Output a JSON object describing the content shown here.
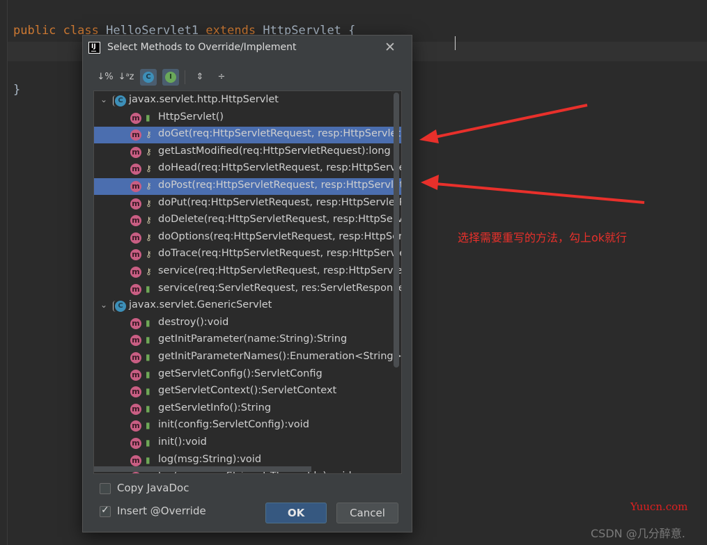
{
  "editor": {
    "line1": {
      "kw1": "public",
      "kw2": "class",
      "name": "HelloServlet1",
      "kw3": "extends",
      "parent": "HttpServlet",
      "brace": "{"
    },
    "line2": {
      "brace": "}"
    }
  },
  "dialog": {
    "app_icon_text": "IJ",
    "title": "Select Methods to Override/Implement",
    "close_glyph": "✕",
    "toolbar": [
      {
        "icon": "sort-visibility-icon",
        "glyph": "↓%"
      },
      {
        "icon": "sort-alpha-icon",
        "glyph": "↓ᵃz"
      },
      {
        "icon": "show-classes-icon",
        "glyph": "C"
      },
      {
        "icon": "show-interfaces-icon",
        "glyph": "I"
      },
      {
        "icon": "expand-all-icon",
        "glyph": "⇕"
      },
      {
        "icon": "collapse-all-icon",
        "glyph": "÷"
      }
    ],
    "tree": [
      {
        "type": "class",
        "label": "javax.servlet.http.HttpServlet",
        "icon_letter": "C"
      },
      {
        "type": "method",
        "label": "HttpServlet()",
        "visibility": "public",
        "selected": false
      },
      {
        "type": "method",
        "label": "doGet(req:HttpServletRequest, resp:HttpServletR",
        "visibility": "protected",
        "selected": true
      },
      {
        "type": "method",
        "label": "getLastModified(req:HttpServletRequest):long",
        "visibility": "protected",
        "selected": false
      },
      {
        "type": "method",
        "label": "doHead(req:HttpServletRequest, resp:HttpServle",
        "visibility": "protected",
        "selected": false
      },
      {
        "type": "method",
        "label": "doPost(req:HttpServletRequest, resp:HttpServlet",
        "visibility": "protected",
        "selected": true
      },
      {
        "type": "method",
        "label": "doPut(req:HttpServletRequest, resp:HttpServletR",
        "visibility": "protected",
        "selected": false
      },
      {
        "type": "method",
        "label": "doDelete(req:HttpServletRequest, resp:HttpServl",
        "visibility": "protected",
        "selected": false
      },
      {
        "type": "method",
        "label": "doOptions(req:HttpServletRequest, resp:HttpSer",
        "visibility": "protected",
        "selected": false
      },
      {
        "type": "method",
        "label": "doTrace(req:HttpServletRequest, resp:HttpServle",
        "visibility": "protected",
        "selected": false
      },
      {
        "type": "method",
        "label": "service(req:HttpServletRequest, resp:HttpServletR",
        "visibility": "protected",
        "selected": false
      },
      {
        "type": "method",
        "label": "service(req:ServletRequest, res:ServletResponse)",
        "visibility": "public",
        "selected": false
      },
      {
        "type": "class",
        "label": "javax.servlet.GenericServlet",
        "icon_letter": "C"
      },
      {
        "type": "method",
        "label": "destroy():void",
        "visibility": "public",
        "selected": false
      },
      {
        "type": "method",
        "label": "getInitParameter(name:String):String",
        "visibility": "public",
        "selected": false
      },
      {
        "type": "method",
        "label": "getInitParameterNames():Enumeration<String>",
        "visibility": "public",
        "selected": false
      },
      {
        "type": "method",
        "label": "getServletConfig():ServletConfig",
        "visibility": "public",
        "selected": false
      },
      {
        "type": "method",
        "label": "getServletContext():ServletContext",
        "visibility": "public",
        "selected": false
      },
      {
        "type": "method",
        "label": "getServletInfo():String",
        "visibility": "public",
        "selected": false
      },
      {
        "type": "method",
        "label": "init(config:ServletConfig):void",
        "visibility": "public",
        "selected": false
      },
      {
        "type": "method",
        "label": "init():void",
        "visibility": "public",
        "selected": false
      },
      {
        "type": "method",
        "label": "log(msg:String):void",
        "visibility": "public",
        "selected": false
      },
      {
        "type": "method",
        "label": "log(message:String, t:Throwable):void",
        "visibility": "public",
        "selected": false
      }
    ],
    "copy_javadoc": {
      "label": "Copy JavaDoc",
      "checked": false
    },
    "insert_override": {
      "label": "Insert @Override",
      "checked": true
    },
    "ok_label": "OK",
    "cancel_label": "Cancel"
  },
  "annotation": {
    "text": "选择需要重写的方法，勾上ok就行",
    "color": "#e8302b"
  },
  "watermarks": {
    "site": "Yuucn.com",
    "csdn": "CSDN @几分醉意."
  }
}
